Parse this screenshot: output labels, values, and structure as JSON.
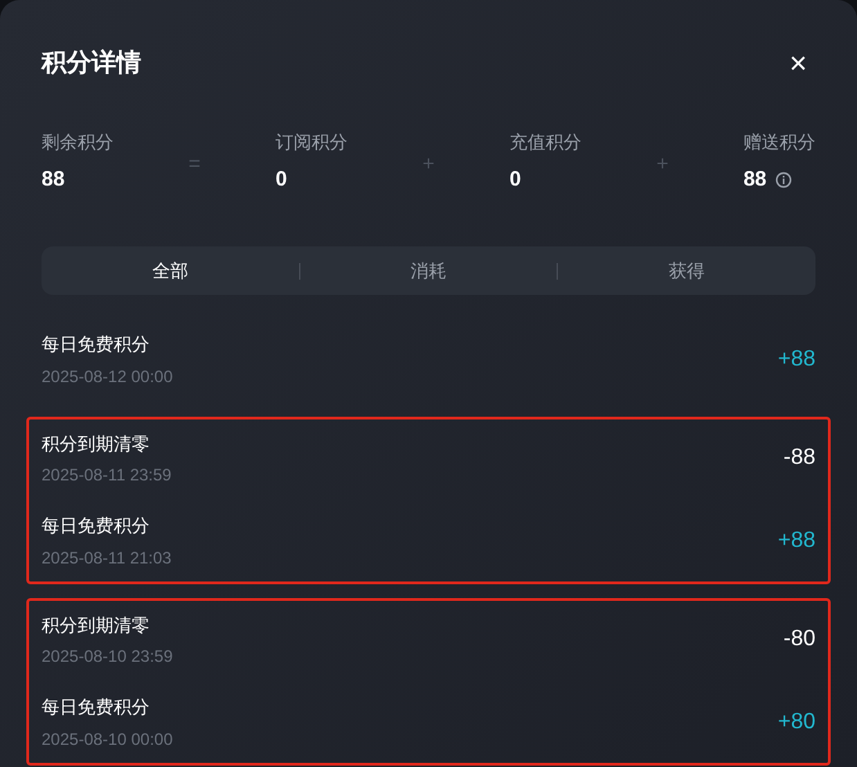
{
  "dialog": {
    "title": "积分详情",
    "close": "×"
  },
  "summary": [
    {
      "label": "剩余积分",
      "value": "88",
      "operator": "="
    },
    {
      "label": "订阅积分",
      "value": "0",
      "operator": "+"
    },
    {
      "label": "充值积分",
      "value": "0",
      "operator": "+"
    },
    {
      "label": "赠送积分",
      "value": "88",
      "info": true
    }
  ],
  "tabs": [
    {
      "label": "全部",
      "selected": true
    },
    {
      "label": "消耗",
      "selected": false
    },
    {
      "label": "获得",
      "selected": false
    }
  ],
  "record_groups": [
    {
      "highlighted": false,
      "records": [
        {
          "title": "每日免费积分",
          "time": "2025-08-12 00:00",
          "amount": "+88",
          "kind": "gain"
        }
      ]
    },
    {
      "highlighted": true,
      "records": [
        {
          "title": "积分到期清零",
          "time": "2025-08-11 23:59",
          "amount": "-88",
          "kind": "loss"
        },
        {
          "title": "每日免费积分",
          "time": "2025-08-11 21:03",
          "amount": "+88",
          "kind": "gain"
        }
      ]
    },
    {
      "highlighted": true,
      "records": [
        {
          "title": "积分到期清零",
          "time": "2025-08-10 23:59",
          "amount": "-80",
          "kind": "loss"
        },
        {
          "title": "每日免费积分",
          "time": "2025-08-10 00:00",
          "amount": "+80",
          "kind": "gain"
        }
      ]
    }
  ]
}
